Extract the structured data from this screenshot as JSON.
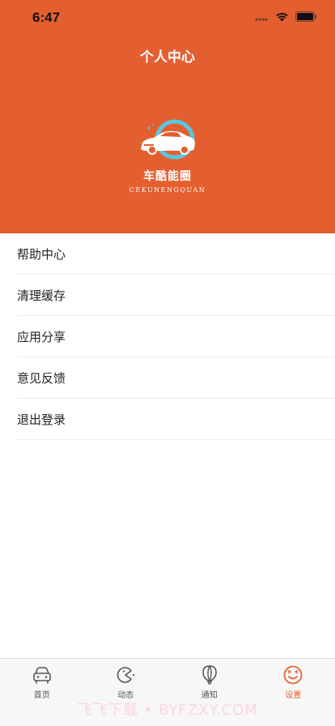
{
  "status_bar": {
    "time": "6:47"
  },
  "header": {
    "title": "个人中心",
    "brand_name": "车酷能圈",
    "brand_subtitle": "CEKUNENGQUAN"
  },
  "menu": {
    "items": [
      {
        "label": "帮助中心",
        "icon": "help-center"
      },
      {
        "label": "清理缓存",
        "icon": "clear-cache"
      },
      {
        "label": "应用分享",
        "icon": "share-app"
      },
      {
        "label": "意见反馈",
        "icon": "feedback"
      },
      {
        "label": "退出登录",
        "icon": "logout"
      }
    ]
  },
  "tabbar": {
    "tabs": [
      {
        "label": "首页",
        "icon": "car-icon",
        "active": false
      },
      {
        "label": "动态",
        "icon": "pacman-icon",
        "active": false
      },
      {
        "label": "通知",
        "icon": "balloon-icon",
        "active": false
      },
      {
        "label": "设置",
        "icon": "smiley-icon",
        "active": true
      }
    ]
  },
  "watermark": "飞飞下载 • BYFZXY.COM",
  "colors": {
    "accent": "#e45f30",
    "logo_ring": "#5bc6de",
    "tab_inactive": "#555555"
  }
}
